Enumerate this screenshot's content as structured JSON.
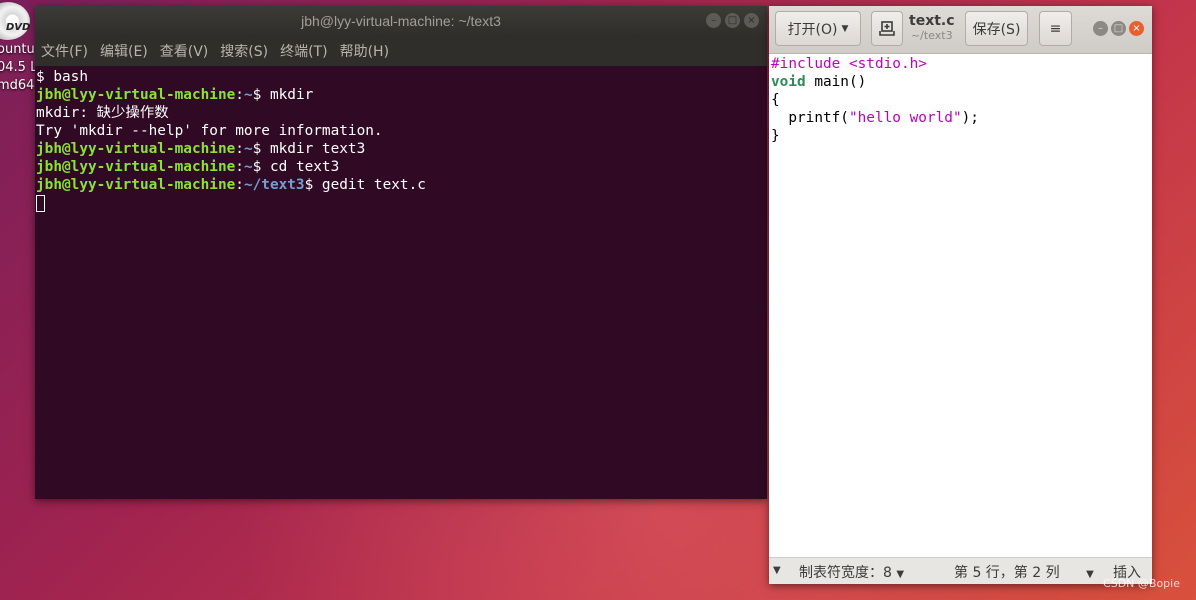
{
  "desktop": {
    "icon_text": "DVD",
    "labels": [
      "ountu",
      "04.5 L",
      "md64"
    ]
  },
  "terminal": {
    "title": "jbh@lyy-virtual-machine: ~/text3",
    "menu": [
      "文件(F)",
      "编辑(E)",
      "查看(V)",
      "搜索(S)",
      "终端(T)",
      "帮助(H)"
    ],
    "lines": [
      {
        "plain": "$ bash"
      },
      {
        "user": "jbh@lyy-virtual-machine",
        "path": "~",
        "cmd": "$ mkdir"
      },
      {
        "plain": "mkdir: 缺少操作数"
      },
      {
        "plain": "Try 'mkdir --help' for more information."
      },
      {
        "user": "jbh@lyy-virtual-machine",
        "path": "~",
        "cmd": "$ mkdir text3"
      },
      {
        "user": "jbh@lyy-virtual-machine",
        "path": "~",
        "cmd": "$ cd text3"
      },
      {
        "user": "jbh@lyy-virtual-machine",
        "path": "~/text3",
        "cmd": "$ gedit text.c"
      }
    ]
  },
  "gedit": {
    "open_label": "打开(O)",
    "title": "text.c",
    "subtitle": "~/text3",
    "save_label": "保存(S)",
    "menu_icon": "≡",
    "code": {
      "l1_directive": "#include",
      "l1_header": "<stdio.h>",
      "l2_type": "void",
      "l2_rest": " main()",
      "l3": "{",
      "l4_pre": "  printf(",
      "l4_string": "\"hello world\"",
      "l4_post": ");",
      "l5": "}"
    },
    "status": {
      "tab_width": "制表符宽度：8",
      "position": "第 5 行，第 2 列",
      "mode": "插入"
    }
  },
  "watermark": "CSDN @Bopie"
}
